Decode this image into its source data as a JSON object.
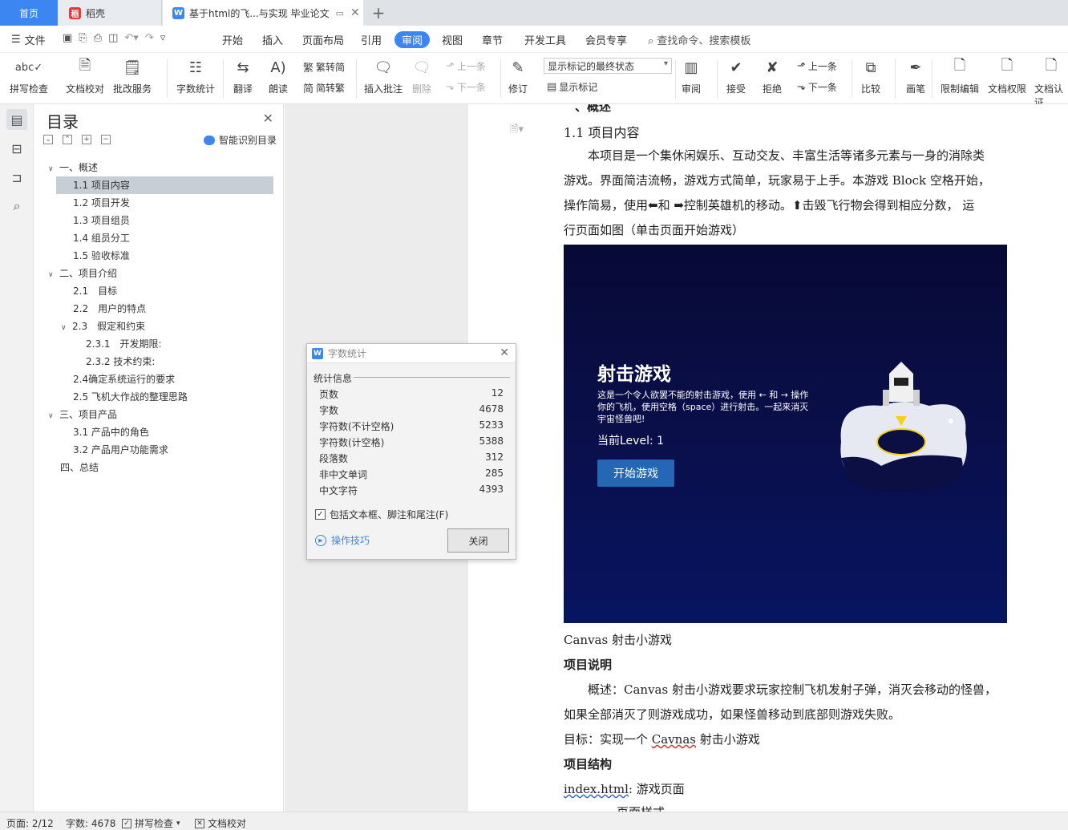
{
  "tabs": {
    "home": "首页",
    "daoke": "稻壳",
    "doc": "基于html的飞...与实现 毕业论文"
  },
  "menu": {
    "file": "文件",
    "items": [
      "开始",
      "插入",
      "页面布局",
      "引用",
      "审阅",
      "视图",
      "章节",
      "开发工具",
      "会员专享"
    ],
    "search": "查找命令、搜索模板"
  },
  "ribbon": {
    "spell": "拼写检查",
    "proof": "文档校对",
    "revise_service": "批改服务",
    "word_count": "字数统计",
    "translate": "翻译",
    "read_aloud": "朗读",
    "trad_to_simp": "繁转简",
    "simp_to_trad": "简转繁",
    "insert_comment": "插入批注",
    "delete": "删除",
    "prev_comment": "上一条",
    "next_comment": "下一条",
    "track": "修订",
    "markup_state": "显示标记的最终状态",
    "show_markup": "显示标记",
    "review": "审阅",
    "accept": "接受",
    "reject": "拒绝",
    "prev": "上一条",
    "next": "下一条",
    "compare": "比较",
    "pen": "画笔",
    "restrict": "限制编辑",
    "permission": "文档权限",
    "certify": "文档认证"
  },
  "toc": {
    "title": "目录",
    "smart": "智能识别目录",
    "items": [
      {
        "label": "一、概述"
      },
      {
        "label": "1.1 项目内容"
      },
      {
        "label": "1.2 项目开发"
      },
      {
        "label": "1.3 项目组员"
      },
      {
        "label": "1.4 组员分工"
      },
      {
        "label": "1.5 验收标准"
      },
      {
        "label": "二、项目介绍"
      },
      {
        "label": "2.1　目标"
      },
      {
        "label": "2.2　用户的特点"
      },
      {
        "label": "2.3　假定和约束"
      },
      {
        "label": "2.3.1　开发期限:"
      },
      {
        "label": "2.3.2  技术约束:"
      },
      {
        "label": "2.4确定系统运行的要求"
      },
      {
        "label": "2.5 飞机大作战的整理思路"
      },
      {
        "label": "三、项目产品"
      },
      {
        "label": "3.1 产品中的角色"
      },
      {
        "label": "3.2 产品用户功能需求"
      },
      {
        "label": "四、总结"
      }
    ]
  },
  "doc": {
    "heading_partial": "、概述",
    "section": "1.1 项目内容",
    "para1": [
      "　　本项目是一个集休闲娱乐、互动交友、丰富生活等诸多元素与一身的消除类",
      "游戏。界面简洁流畅，游戏方式简单，玩家易于上手。本游戏 Block 空格开始，",
      "操作简易，使用⬅和 ➡控制英雄机的移动。⬆击毁飞行物会得到相应分数， 运",
      "行页面如图（单击页面开始游戏）"
    ],
    "caption": "Canvas  射击小游戏",
    "desc_heading": "项目说明",
    "desc1": "　　概述：Canvas  射击小游戏要求玩家控制飞机发射子弹，消灭会移动的怪兽，",
    "desc2": "如果全部消灭了则游戏成功，如果怪兽移动到底部则游戏失败。",
    "goal_prefix": "目标：实现一个  ",
    "goal_word": "Cavnas",
    "goal_suffix": " 射击小游戏",
    "struct_heading": "项目结构",
    "struct_file": "index.html",
    "struct_desc": ": 游戏页面",
    "cut_line": "页面样式"
  },
  "game": {
    "title": "射击游戏",
    "desc": "这是一个令人欲罢不能的射击游戏，使用 ← 和 → 操作你的飞机，使用空格（space）进行射击。一起来消灭宇宙怪兽吧!",
    "level": "当前Level: 1",
    "start": "开始游戏"
  },
  "dialog": {
    "title": "字数统计",
    "section": "统计信息",
    "rows": [
      {
        "label": "页数",
        "value": "12"
      },
      {
        "label": "字数",
        "value": "4678"
      },
      {
        "label": "字符数(不计空格)",
        "value": "5233"
      },
      {
        "label": "字符数(计空格)",
        "value": "5388"
      },
      {
        "label": "段落数",
        "value": "312"
      },
      {
        "label": "非中文单词",
        "value": "285"
      },
      {
        "label": "中文字符",
        "value": "4393"
      }
    ],
    "include": "包括文本框、脚注和尾注(F)",
    "tips": "操作技巧",
    "close": "关闭"
  },
  "status": {
    "page": "页面: 2/12",
    "words": "字数: 4678",
    "spell": "拼写检查",
    "proof": "文档校对"
  }
}
